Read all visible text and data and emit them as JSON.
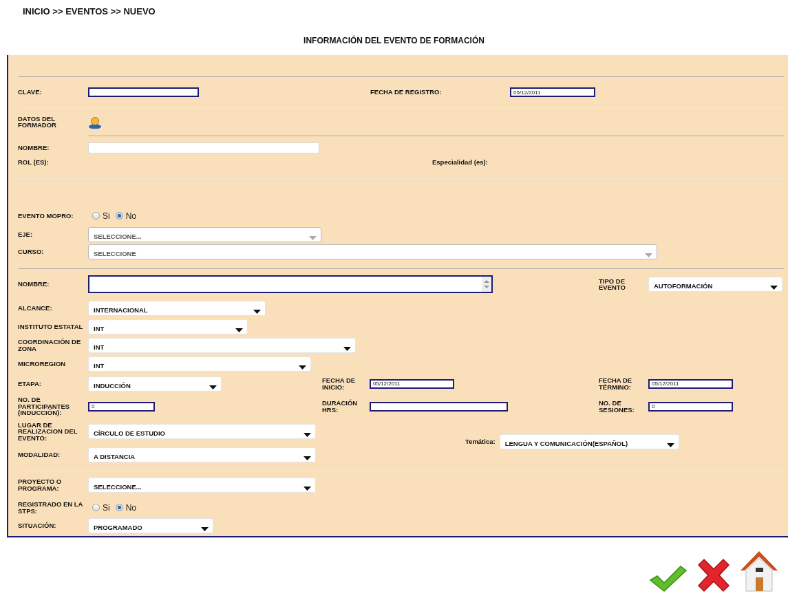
{
  "breadcrumb": "INICIO >> EVENTOS >> NUEVO",
  "title": "INFORMACIÓN DEL EVENTO DE FORMACIÓN",
  "clave": {
    "label": "CLAVE:"
  },
  "fecha_registro": {
    "label": "FECHA DE REGISTRO:",
    "value": "05/12/2011"
  },
  "formador": {
    "heading": "DATOS DEL FORMADOR",
    "nombre_label": "NOMBRE:",
    "rol_label": "ROL (ES):",
    "especialidad_label": "Especialidad (es):"
  },
  "evento_mopro": {
    "label": "EVENTO MOPRO:",
    "options": [
      {
        "label": "Si",
        "selected": false
      },
      {
        "label": "No",
        "selected": true
      }
    ]
  },
  "eje": {
    "label": "EJE:",
    "value": "SELECCIONE..."
  },
  "curso": {
    "label": "CURSO:",
    "value": "SELECCIONE"
  },
  "nombre": {
    "label": "NOMBRE:"
  },
  "tipo_evento": {
    "label": "TIPO DE EVENTO",
    "value": "AUTOFORMACIÓN"
  },
  "alcance": {
    "label": "ALCANCE:",
    "value": "INTERNACIONAL"
  },
  "instituto": {
    "label": "INSTITUTO ESTATAL",
    "value": "INT"
  },
  "coordinacion": {
    "label": "COORDINACIÓN DE ZONA",
    "value": "INT"
  },
  "microregion": {
    "label": "MICROREGION",
    "value": "INT"
  },
  "etapa": {
    "label": "ETAPA:",
    "value": "INDUCCIÓN"
  },
  "fecha_inicio": {
    "label": "FECHA DE INICIO:",
    "value": "05/12/2011"
  },
  "fecha_termino": {
    "label": "FECHA DE TÉRMINO:",
    "value": "05/12/2011"
  },
  "participantes": {
    "label": "NO. DE PARTICIPANTES (INDUCCIÓN):",
    "value": "0"
  },
  "duracion": {
    "label": "DURACIÓN HRS:"
  },
  "sesiones": {
    "label": "NO. DE SESIONES:",
    "value": "0"
  },
  "lugar": {
    "label": "LUGAR DE REALIZACION DEL EVENTO:",
    "value": "CÍRCULO DE ESTUDIO"
  },
  "tematica": {
    "label": "Temática:",
    "value": "LENGUA Y COMUNICACIÓN(ESPAÑOL)"
  },
  "modalidad": {
    "label": "MODALIDAD:",
    "value": "A DISTANCIA"
  },
  "proyecto": {
    "label": "PROYECTO O PROGRAMA:",
    "value": "SELECCIONE..."
  },
  "registrado": {
    "label": "REGISTRADO EN LA STPS:",
    "options": [
      {
        "label": "Si",
        "selected": false
      },
      {
        "label": "No",
        "selected": true
      }
    ]
  },
  "situacion": {
    "label": "SITUACIÓN:",
    "value": "PROGRAMADO"
  },
  "actions": [
    {
      "kind": "accept"
    },
    {
      "kind": "cancel"
    },
    {
      "kind": "home"
    }
  ]
}
